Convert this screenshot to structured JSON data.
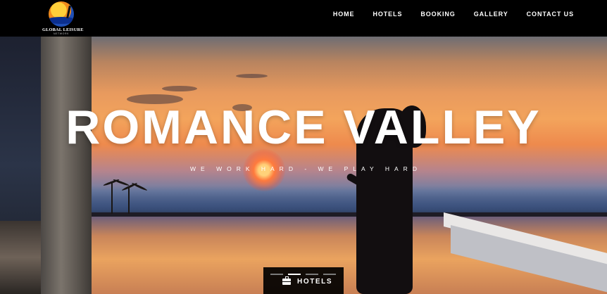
{
  "header": {
    "logo": {
      "name": "GLOBAL LEISURE",
      "tagline": "NETWORK"
    },
    "nav": [
      {
        "label": "HOME"
      },
      {
        "label": "HOTELS"
      },
      {
        "label": "BOOKING"
      },
      {
        "label": "GALLERY"
      },
      {
        "label": "CONTACT US"
      }
    ]
  },
  "hero": {
    "title": "ROMANCE VALLEY",
    "subtitle": "WE WORK HARD - WE PLAY HARD"
  },
  "bottom_tab": {
    "label": "HOTELS",
    "icon": "suitcase-icon",
    "slide_count": 4,
    "active_slide": 2
  }
}
